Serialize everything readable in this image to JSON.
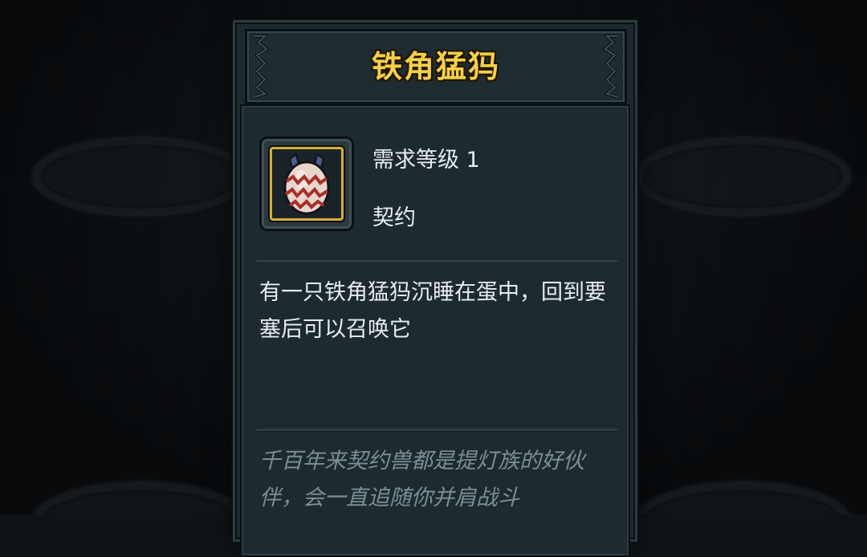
{
  "item": {
    "title": "铁角猛犸",
    "requirement": "需求等级 1",
    "type": "契约",
    "description": "有一只铁角猛犸沉睡在蛋中，回到要塞后可以召唤它",
    "lore": "千百年来契约兽都是提灯族的好伙伴，会一直追随你并肩战斗",
    "icon": "monster-egg-icon"
  },
  "colors": {
    "title": "#f3d048",
    "panel": "#1c2a30",
    "frame_gold": "#d6ae3a",
    "text": "#e8ecee",
    "lore_text": "#7c8e94"
  }
}
